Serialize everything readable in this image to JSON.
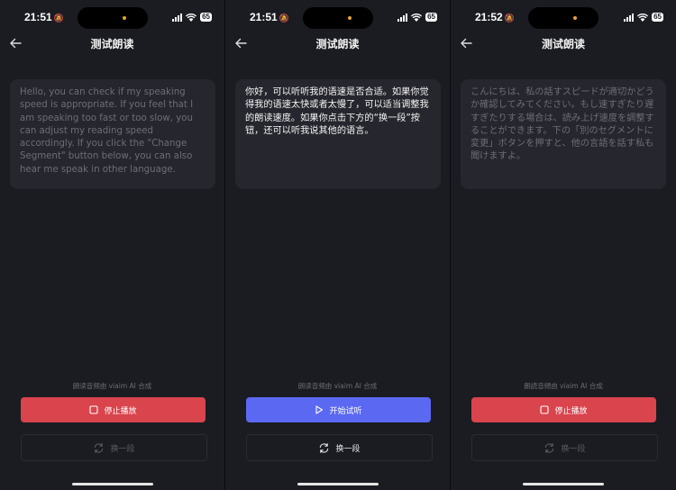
{
  "colors": {
    "background": "#1b1c22",
    "card": "#26272e",
    "stop_button": "#d9444d",
    "play_button": "#5b69f2",
    "island_dot": "#e8a33a"
  },
  "screens": [
    {
      "status": {
        "time": "21:51",
        "battery": "65"
      },
      "title": "测试朗读",
      "text": "Hello, you can check if my speaking speed is appropriate. If you feel that I am speaking too fast or too slow, you can adjust my reading speed accordingly. If you click the \"Change Segment\" button below, you can also hear me speak in other language.",
      "text_state": "dim",
      "credit": "朗读音频由 viaim AI 合成",
      "primary_button": {
        "label": "停止播放",
        "icon": "stop-icon",
        "color": "red"
      },
      "secondary_button": {
        "label": "换一段",
        "icon": "refresh-icon",
        "enabled": false
      }
    },
    {
      "status": {
        "time": "21:51",
        "battery": "65"
      },
      "title": "测试朗读",
      "text": "你好，可以听听我的语速是否合适。如果你觉得我的语速太快或者太慢了，可以适当调整我的朗读速度。如果你点击下方的“换一段”按钮，还可以听我说其他的语言。",
      "text_state": "bright",
      "credit": "朗读音频由 viaim AI 合成",
      "primary_button": {
        "label": "开始试听",
        "icon": "play-icon",
        "color": "blue"
      },
      "secondary_button": {
        "label": "换一段",
        "icon": "refresh-icon",
        "enabled": true
      }
    },
    {
      "status": {
        "time": "21:52",
        "battery": "65"
      },
      "title": "测试朗读",
      "text": "こんにちは、私の話すスピードが適切かどうか確認してみてください。もし速すぎたり遅すぎたりする場合は、読み上げ速度を調整することができます。下の「別のセグメントに変更」ボタンを押すと、他の言語を話す私も聞けますよ。",
      "text_state": "dim",
      "credit": "朗読音頻由 viaim AI 合成",
      "primary_button": {
        "label": "停止播放",
        "icon": "stop-icon",
        "color": "red"
      },
      "secondary_button": {
        "label": "换一段",
        "icon": "refresh-icon",
        "enabled": false
      }
    }
  ]
}
